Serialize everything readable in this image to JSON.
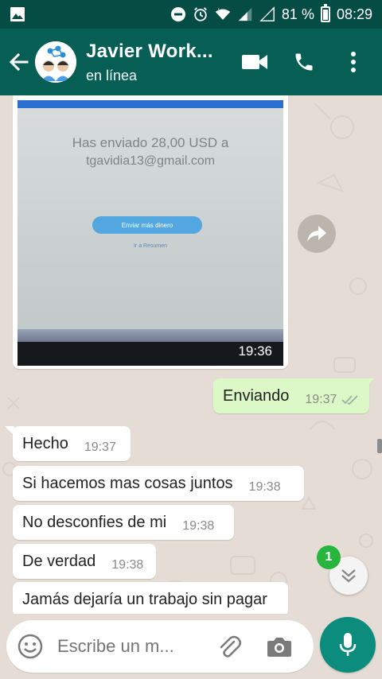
{
  "status_bar": {
    "battery_percent": "81 %",
    "time": "08:29",
    "battery_level": 0.81
  },
  "header": {
    "contact_name": "Javier Work...",
    "status": "en línea",
    "icons": [
      "back-arrow-icon",
      "video-call-icon",
      "phone-icon",
      "more-vert-icon"
    ]
  },
  "image_message": {
    "line1": "Has enviado 28,00 USD a",
    "line2": "tgavidia13@gmail.com",
    "button_text": "Enviar más dinero",
    "link_text": "Ir a Resumen",
    "time": "19:36"
  },
  "messages": [
    {
      "text": "Enviando",
      "time": "19:37",
      "direction": "out",
      "read": true
    },
    {
      "text": "Hecho",
      "time": "19:37",
      "direction": "in"
    },
    {
      "text": "Si hacemos mas cosas juntos",
      "time": "19:38",
      "direction": "in"
    },
    {
      "text": "No desconfies de mi",
      "time": "19:38",
      "direction": "in"
    },
    {
      "text": "De verdad",
      "time": "19:38",
      "direction": "in"
    },
    {
      "text": "Jamás dejaría un trabajo sin pagar",
      "time": "",
      "direction": "in"
    }
  ],
  "scroll_down": {
    "unread_count": "1"
  },
  "composer": {
    "placeholder": "Escribe un m...",
    "icons": [
      "emoji-icon",
      "attach-icon",
      "camera-icon",
      "mic-icon"
    ]
  },
  "colors": {
    "header": "#075e54",
    "statusbar": "#054d44",
    "chat_bg": "#e5ddd5",
    "outgoing_bubble": "#dcf8c6",
    "mic_button": "#0b8c7d",
    "badge": "#27b53e"
  }
}
